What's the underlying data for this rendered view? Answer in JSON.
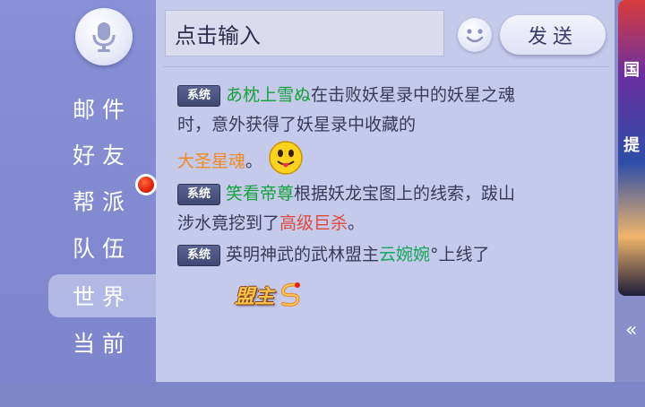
{
  "sidebar": {
    "tabs": [
      {
        "label": "邮件"
      },
      {
        "label": "好友"
      },
      {
        "label": "帮派"
      },
      {
        "label": "队伍"
      },
      {
        "label": "世界"
      },
      {
        "label": "当前"
      }
    ],
    "active_tab": "世界",
    "notification_dot_color": "#e0220e"
  },
  "input": {
    "placeholder": "点击输入"
  },
  "send_button": {
    "label": "发送"
  },
  "messages": [
    {
      "tag": "系统",
      "player": "あ枕上雪ぬ",
      "line1": "在击败妖星录中的妖星之魂",
      "line2": "时，意外获得了妖星录中收藏的",
      "item": "大圣星魂",
      "end": "。",
      "emoji": "tongue-smiley-icon"
    },
    {
      "tag": "系统",
      "player": "笑看帝尊",
      "line1": "根据妖龙宝图上的线索，跋山",
      "line2": "涉水竟挖到了",
      "item": "高级巨杀",
      "end": "。"
    },
    {
      "tag": "系统",
      "prefix": "英明神武的武林盟主",
      "player": "云婉婉",
      "suffix": "°上线了",
      "badge": "盟主"
    }
  ],
  "colors": {
    "player_name": "#12a13a",
    "rare_item": "#e04a3a",
    "legend_item": "#f08a24",
    "accent": "#7f86c8"
  },
  "side_art": {
    "glyph1": "国",
    "glyph2": "提"
  }
}
